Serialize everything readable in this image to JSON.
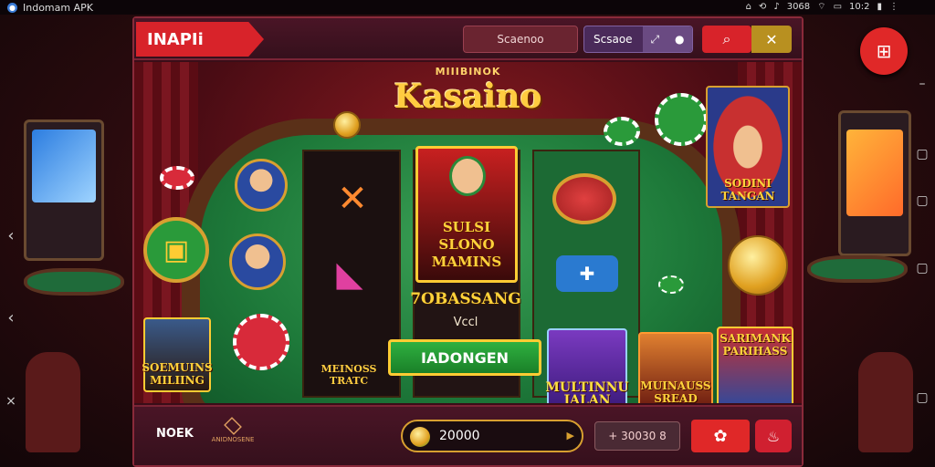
{
  "status_bar": {
    "app_title": "Indomam APK",
    "signal": "3068",
    "time": "10:2"
  },
  "header": {
    "brand": "INAPIi",
    "search_label": "Scaenoo",
    "select_label": "Scsaoe"
  },
  "logo": {
    "small": "MIIIBINOK",
    "big": "Kasaino"
  },
  "featured": {
    "lines": [
      "SULSI",
      "SLONO",
      "MAMINS"
    ]
  },
  "promo": {
    "title": "7OBASSANG",
    "subtitle": "Vccl",
    "cta": "IADONGEN"
  },
  "tiles": {
    "left_lower": [
      "SOEMUINS",
      "MILIING"
    ],
    "center_lower": [
      "MEINOSS",
      "TRATC"
    ],
    "right_card_1": [
      "MULTINNU",
      "JALAN"
    ],
    "right_card_2": [
      "MUINAUSS",
      "SREAD"
    ],
    "right_card_3": [
      "SARIMANK",
      "PARIHASS"
    ],
    "top_right_card": [
      "SODINI",
      "TANGAN"
    ]
  },
  "bottom_bar": {
    "label": "NOEK",
    "logo_text": "ANIDNOSENE",
    "balance": "20000",
    "bet": "+ 30030 8"
  },
  "colors": {
    "accent_red": "#d8232a",
    "gold": "#ffcc33",
    "felt_green": "#1e7a3a",
    "panel_maroon": "#3a0d18"
  }
}
